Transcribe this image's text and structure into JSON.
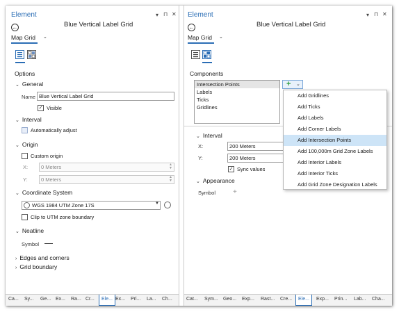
{
  "left": {
    "title": "Element",
    "win_btns": [
      "▾",
      "⊓",
      "✕"
    ],
    "element_name": "Blue Vertical Label Grid",
    "grid_selector": "Map Grid",
    "options_title": "Options",
    "general": {
      "title": "General",
      "name_label": "Name",
      "name_value": "Blue Vertical Label Grid",
      "visible_label": "Visible"
    },
    "interval": {
      "title": "Interval",
      "auto_label": "Automatically adjust"
    },
    "origin": {
      "title": "Origin",
      "custom_label": "Custom origin",
      "x_label": "X:",
      "x_value": "0 Meters",
      "y_label": "Y:",
      "y_value": "0 Meters"
    },
    "coord": {
      "title": "Coordinate System",
      "value": "WGS 1984 UTM Zone 17S",
      "clip_label": "Clip to UTM zone boundary"
    },
    "neatline": {
      "title": "Neatline",
      "symbol_label": "Symbol"
    },
    "edges": "Edges and corners",
    "gridb": "Grid boundary",
    "tabs": [
      "Ca...",
      "Sy...",
      "Ge...",
      "Ex...",
      "Ra...",
      "Cr...",
      "Ele...",
      "Ex...",
      "Pri...",
      "La...",
      "Ch..."
    ]
  },
  "right": {
    "title": "Element",
    "win_btns": [
      "▾",
      "⊓",
      "✕"
    ],
    "element_name": "Blue Vertical Label Grid",
    "grid_selector": "Map Grid",
    "components_title": "Components",
    "components": [
      "Intersection Points",
      "Labels",
      "Ticks",
      "Gridlines"
    ],
    "add_glyph": "+",
    "interval": {
      "title": "Interval",
      "x_label": "X:",
      "x_value": "200 Meters",
      "y_label": "Y:",
      "y_value": "200 Meters",
      "sync_label": "Sync values"
    },
    "appearance": {
      "title": "Appearance",
      "symbol_label": "Symbol",
      "symbol_value": "+"
    },
    "menu": [
      "Add Gridlines",
      "Add Ticks",
      "Add Labels",
      "Add Corner Labels",
      "Add Intersection Points",
      "Add 100,000m Grid Zone Labels",
      "Add Interior Labels",
      "Add Interior Ticks",
      "Add Grid Zone Designation Labels"
    ],
    "tabs": [
      "Cat...",
      "Sym...",
      "Geo...",
      "Exp...",
      "Rast...",
      "Cre...",
      "Ele...",
      "Exp...",
      "Prin...",
      "Lab...",
      "Cha..."
    ]
  },
  "colors": {
    "accent": "#2a6db5",
    "menu_highlight": "#cde4f7",
    "add_icon": "#2e9e3f"
  }
}
